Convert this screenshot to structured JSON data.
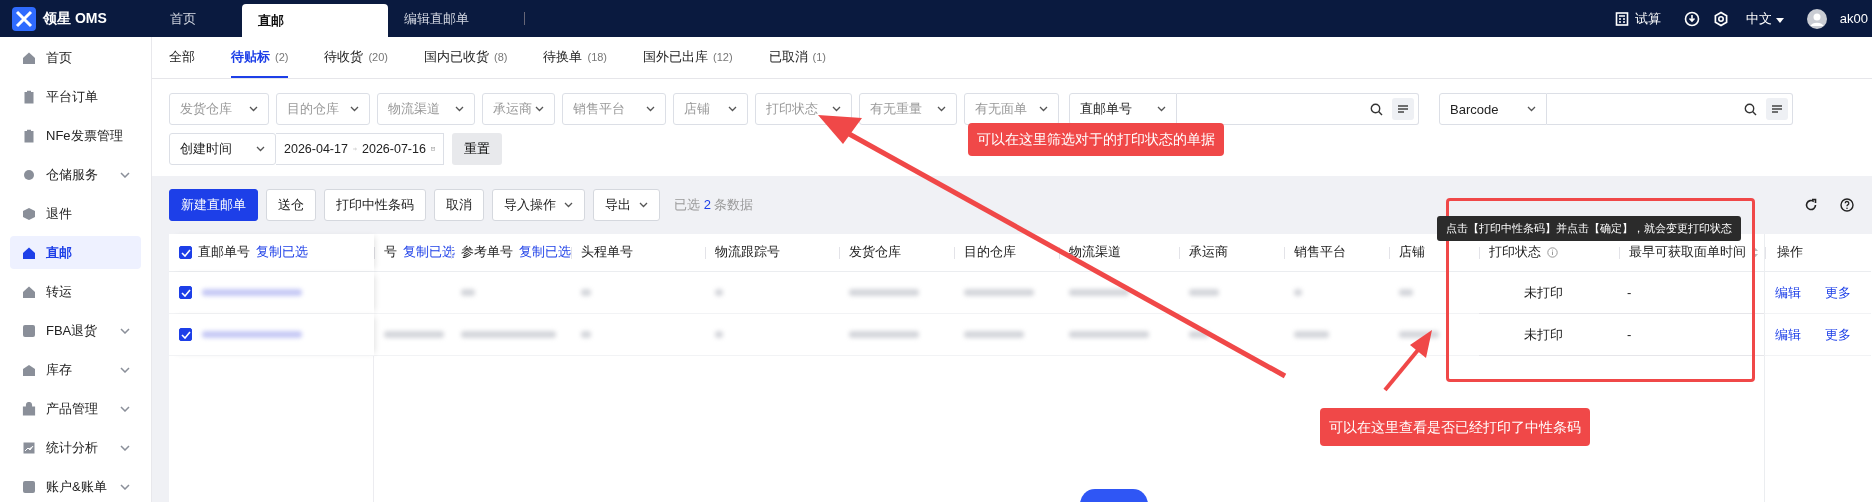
{
  "app": {
    "logo_text": "领星 OMS"
  },
  "top_tabs": [
    {
      "label": "首页",
      "selected": false
    },
    {
      "label": "直邮",
      "selected": true
    },
    {
      "label": "编辑直邮单",
      "selected": false
    }
  ],
  "top_actions": {
    "calc": "试算",
    "language": "中文",
    "user": "ak00"
  },
  "sidebar": {
    "items": [
      {
        "label": "首页",
        "selected": false,
        "expandable": false
      },
      {
        "label": "平台订单",
        "selected": false,
        "expandable": false
      },
      {
        "label": "NFe发票管理",
        "selected": false,
        "expandable": false
      },
      {
        "label": "仓储服务",
        "selected": false,
        "expandable": true
      },
      {
        "label": "退件",
        "selected": false,
        "expandable": false
      },
      {
        "label": "直邮",
        "selected": true,
        "expandable": false
      },
      {
        "label": "转运",
        "selected": false,
        "expandable": false
      },
      {
        "label": "FBA退货",
        "selected": false,
        "expandable": true
      },
      {
        "label": "库存",
        "selected": false,
        "expandable": true
      },
      {
        "label": "产品管理",
        "selected": false,
        "expandable": true
      },
      {
        "label": "统计分析",
        "selected": false,
        "expandable": true
      },
      {
        "label": "账户&账单",
        "selected": false,
        "expandable": true
      }
    ]
  },
  "status_tabs": [
    {
      "label": "全部",
      "selected": false
    },
    {
      "label": "待贴标",
      "count": "(2)",
      "selected": true
    },
    {
      "label": "待收货",
      "count": "(20)",
      "selected": false
    },
    {
      "label": "国内已收货",
      "count": "(8)",
      "selected": false
    },
    {
      "label": "待换单",
      "count": "(18)",
      "selected": false
    },
    {
      "label": "国外已出库",
      "count": "(12)",
      "selected": false
    },
    {
      "label": "已取消",
      "count": "(1)",
      "selected": false
    }
  ],
  "filters": {
    "selects": [
      {
        "placeholder": "发货仓库"
      },
      {
        "placeholder": "目的仓库"
      },
      {
        "placeholder": "物流渠道"
      },
      {
        "placeholder": "承运商"
      },
      {
        "placeholder": "销售平台"
      },
      {
        "placeholder": "店铺"
      },
      {
        "placeholder": "打印状态"
      },
      {
        "placeholder": "有无重量"
      },
      {
        "placeholder": "有无面单"
      }
    ],
    "searches": [
      {
        "type_label": "直邮单号"
      },
      {
        "type_label": "Barcode"
      }
    ],
    "date": {
      "type_label": "创建时间",
      "start": "2026-04-17",
      "end": "2026-07-16"
    },
    "reset": "重置"
  },
  "toolbar": {
    "buttons": [
      {
        "label": "新建直邮单",
        "kind": "primary"
      },
      {
        "label": "送仓",
        "kind": "plain"
      },
      {
        "label": "打印中性条码",
        "kind": "plain"
      },
      {
        "label": "取消",
        "kind": "plain"
      },
      {
        "label": "导入操作",
        "kind": "dropdown"
      },
      {
        "label": "导出",
        "kind": "dropdown"
      }
    ],
    "selection_prefix": "已选",
    "selection_count": "2",
    "selection_suffix": "条数据"
  },
  "table": {
    "header_checked": true,
    "columns": [
      {
        "label": "直邮单号",
        "action": "复制已选"
      },
      {
        "label": "号",
        "action": "复制已选"
      },
      {
        "label": "参考单号",
        "action": "复制已选"
      },
      {
        "label": "头程单号"
      },
      {
        "label": "物流跟踪号"
      },
      {
        "label": "发货仓库"
      },
      {
        "label": "目的仓库"
      },
      {
        "label": "物流渠道"
      },
      {
        "label": "承运商"
      },
      {
        "label": "销售平台"
      },
      {
        "label": "店铺"
      },
      {
        "label": "打印状态"
      },
      {
        "label": "最早可获取面单时间"
      },
      {
        "label": "操作"
      }
    ],
    "rows": [
      {
        "selected": true,
        "print_status": "未打印",
        "label_time": "-",
        "actions": [
          "编辑",
          "更多"
        ]
      },
      {
        "selected": true,
        "print_status": "未打印",
        "label_time": "-",
        "actions": [
          "编辑",
          "更多"
        ]
      }
    ]
  },
  "annotations": {
    "tooltip": "点击【打印中性条码】并点击【确定】，就会变更打印状态",
    "callouts": [
      "可以在这里筛选对于的打印状态的单据",
      "可以在这里查看是否已经打印了中性条码"
    ]
  }
}
